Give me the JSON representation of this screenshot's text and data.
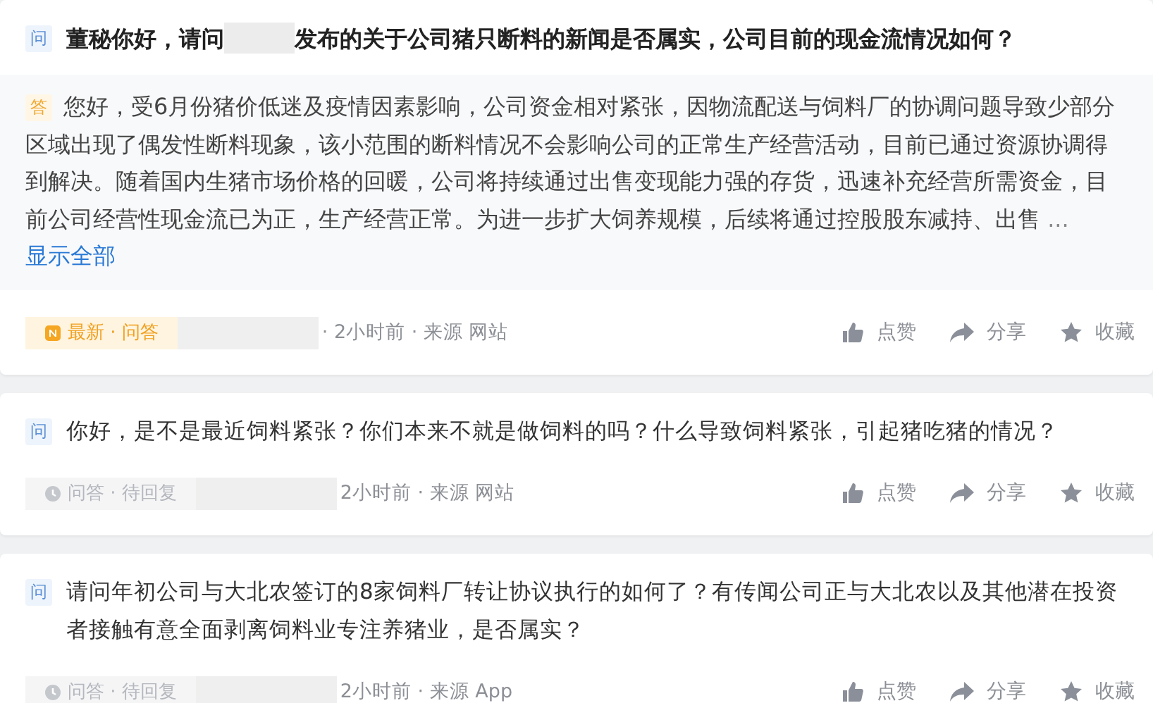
{
  "posts": [
    {
      "kind": "answered",
      "question_badge": "问",
      "question": [
        {
          "kind": "text",
          "text": "董秘你好，请问"
        },
        {
          "kind": "redacted"
        },
        {
          "kind": "text",
          "text": "发布的关于公司猪只断料的新闻是否属实，公司目前的现金流情况如何？"
        }
      ],
      "answer": {
        "badge": "答",
        "text": "您好，受6月份猪价低迷及疫情因素影响，公司资金相对紧张，因物流配送与饲料厂的协调问题导致少部分区域出现了偶发性断料现象，该小范围的断料情况不会影响公司的正常生产经营活动，目前已通过资源协调得到解决。随着国内生猪市场价格的回暖，公司将持续通过出售变现能力强的存货，迅速补充经营所需资金，目前公司经营性现金流已为正，生产经营正常。为进一步扩大饲养规模，后续将通过控股股东减持、出售 ",
        "ellipsis": "...",
        "more_link": "显示全部"
      },
      "footer": {
        "tag": {
          "kind": "latest",
          "text": "最新 · 问答"
        },
        "meta": "· 2小时前 · 来源 网站"
      },
      "actions": [
        {
          "kind": "like",
          "label": "点赞"
        },
        {
          "kind": "share",
          "label": "分享"
        },
        {
          "kind": "favorite",
          "label": "收藏"
        }
      ]
    },
    {
      "kind": "pending",
      "question_badge": "问",
      "question": [
        {
          "kind": "text",
          "text": "你好，是不是最近饲料紧张？你们本来不就是做饲料的吗？什么导致饲料紧张，引起猪吃猪的情况？"
        }
      ],
      "footer": {
        "tag": {
          "kind": "pending",
          "text": "问答 · 待回复"
        },
        "meta": "2小时前 · 来源 网站"
      },
      "actions": [
        {
          "kind": "like",
          "label": "点赞"
        },
        {
          "kind": "share",
          "label": "分享"
        },
        {
          "kind": "favorite",
          "label": "收藏"
        }
      ]
    },
    {
      "kind": "pending",
      "question_badge": "问",
      "question": [
        {
          "kind": "text",
          "text": "请问年初公司与大北农签订的8家饲料厂转让协议执行的如何了？有传闻公司正与大北农以及其他潜在投资者接触有意全面剥离饲料业专注养猪业，是否属实？"
        }
      ],
      "footer": {
        "tag": {
          "kind": "pending",
          "text": "问答 · 待回复"
        },
        "meta": "2小时前 · 来源 App"
      },
      "actions": [
        {
          "kind": "like",
          "label": "点赞"
        },
        {
          "kind": "share",
          "label": "分享"
        },
        {
          "kind": "favorite",
          "label": "收藏"
        }
      ]
    }
  ]
}
